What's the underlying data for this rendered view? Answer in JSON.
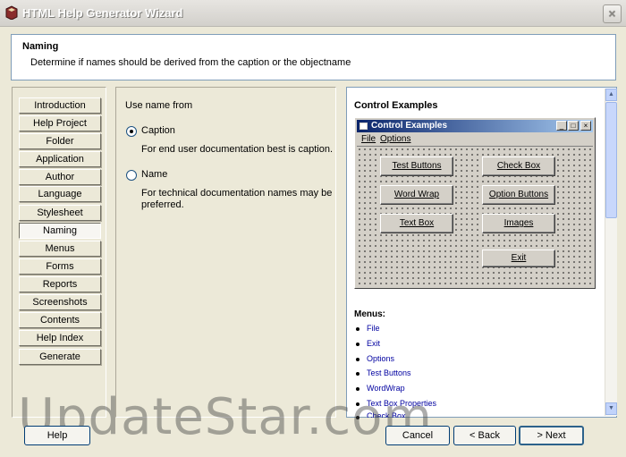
{
  "window": {
    "title": "HTML Help Generator Wizard",
    "close_label": "×"
  },
  "header": {
    "title": "Naming",
    "description": "Determine if names should be derived from the caption or the objectname"
  },
  "nav": {
    "items": [
      {
        "label": "Introduction"
      },
      {
        "label": "Help Project"
      },
      {
        "label": "Folder"
      },
      {
        "label": "Application"
      },
      {
        "label": "Author"
      },
      {
        "label": "Language"
      },
      {
        "label": "Stylesheet"
      },
      {
        "label": "Naming",
        "active": true
      },
      {
        "label": "Menus"
      },
      {
        "label": "Forms"
      },
      {
        "label": "Reports"
      },
      {
        "label": "Screenshots"
      },
      {
        "label": "Contents"
      },
      {
        "label": "Help Index"
      },
      {
        "label": "Generate"
      }
    ]
  },
  "options": {
    "group_label": "Use name from",
    "caption": {
      "label": "Caption",
      "description": "For end user documentation best is caption.",
      "checked": true
    },
    "name": {
      "label": "Name",
      "description": "For technical documentation names may be preferred.",
      "checked": false
    }
  },
  "preview": {
    "title": "Control Examples",
    "window_title": "Control Examples",
    "menu": [
      "File",
      "Options"
    ],
    "buttons": [
      "Test Buttons",
      "Check Box",
      "Word Wrap",
      "Option Buttons",
      "Text Box",
      "Images",
      "Exit"
    ],
    "menus_label": "Menus:",
    "menu_links": [
      "File",
      "Exit",
      "Options",
      "Test Buttons",
      "WordWrap",
      "Text Box Properties",
      "Check Box"
    ]
  },
  "buttons": {
    "help": "Help",
    "cancel": "Cancel",
    "back": "< Back",
    "next": "> Next"
  },
  "watermark": "UpdateStar.com"
}
